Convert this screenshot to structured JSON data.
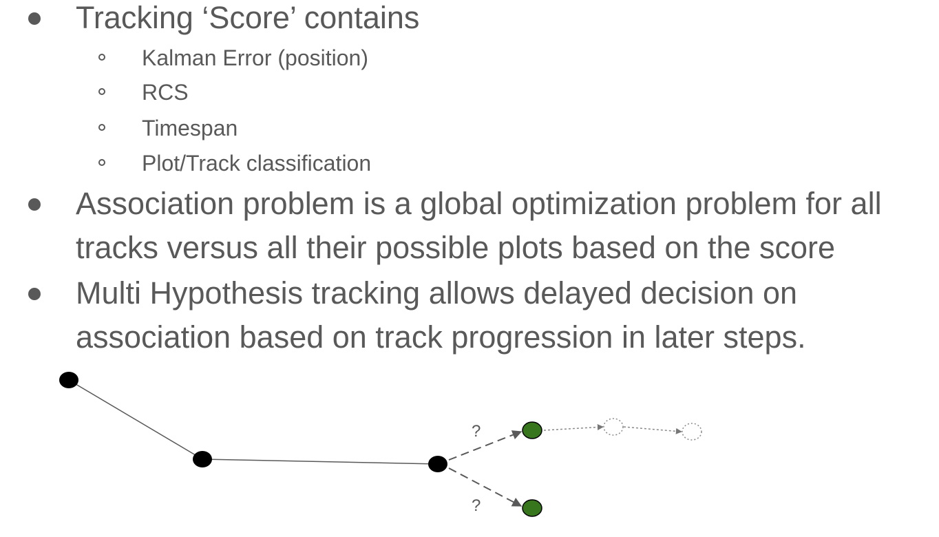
{
  "bullets": [
    {
      "text": "Tracking ‘Score’ contains",
      "sub": [
        "Kalman Error (position)",
        "RCS",
        "Timespan",
        "Plot/Track classification"
      ]
    },
    {
      "lines": [
        "Association problem is a global optimization problem for all",
        "tracks versus all their possible plots based on the score"
      ]
    },
    {
      "lines": [
        "Multi Hypothesis tracking allows delayed decision on",
        "association based on track progression in later steps."
      ]
    }
  ],
  "diagram": {
    "question_marks": [
      "?",
      "?"
    ],
    "colors": {
      "past_node": "#000000",
      "hypothesis_node": "#38761d",
      "future_node_outline": "#999999",
      "edge": "#595959"
    }
  }
}
